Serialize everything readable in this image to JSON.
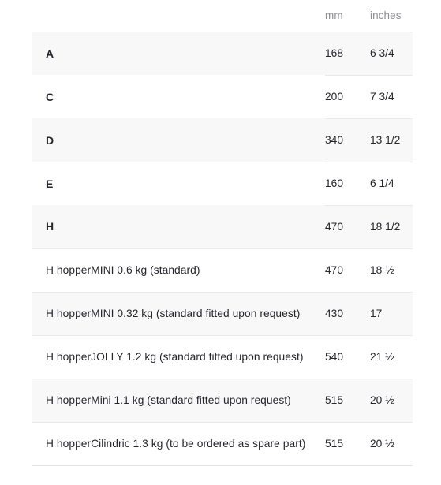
{
  "table": {
    "columns": {
      "label": "",
      "mm": "mm",
      "inches": "inches"
    },
    "rows": [
      {
        "label": "A",
        "mm": "168",
        "inches": "6 3/4",
        "shaded": true,
        "bold": true,
        "section": "letter"
      },
      {
        "label": "C",
        "mm": "200",
        "inches": "7 3/4",
        "shaded": false,
        "bold": true,
        "section": "letter"
      },
      {
        "label": "D",
        "mm": "340",
        "inches": "13 1/2",
        "shaded": true,
        "bold": true,
        "section": "letter"
      },
      {
        "label": "E",
        "mm": "160",
        "inches": "6 1/4",
        "shaded": false,
        "bold": true,
        "section": "letter"
      },
      {
        "label": "H",
        "mm": "470",
        "inches": "18 1/2",
        "shaded": true,
        "bold": true,
        "section": "letter"
      },
      {
        "label": "H hopperMINI 0.6 kg (standard)",
        "mm": "470",
        "inches": "18 ½",
        "shaded": false,
        "bold": false,
        "section": "hopper"
      },
      {
        "label": "H hopperMINI 0.32 kg (standard fitted upon request)",
        "mm": "430",
        "inches": "17",
        "shaded": true,
        "bold": false,
        "section": "hopper"
      },
      {
        "label": "H hopperJOLLY 1.2 kg (standard fitted upon request)",
        "mm": "540",
        "inches": "21 ½",
        "shaded": false,
        "bold": false,
        "section": "hopper"
      },
      {
        "label": "H hopperMini 1.1 kg (standard fitted upon request)",
        "mm": "515",
        "inches": "20 ½",
        "shaded": true,
        "bold": false,
        "section": "hopper"
      },
      {
        "label": "H hopperCilindric 1.3 kg (to be ordered as spare part)",
        "mm": "515",
        "inches": "20 ½",
        "shaded": false,
        "bold": false,
        "section": "hopper"
      }
    ]
  },
  "colors": {
    "page_background": "#ffffff",
    "row_shaded_background": "#f8f8f8",
    "text": "#26262e",
    "header_text": "#8d8d95",
    "border": "#e9e9eb"
  }
}
